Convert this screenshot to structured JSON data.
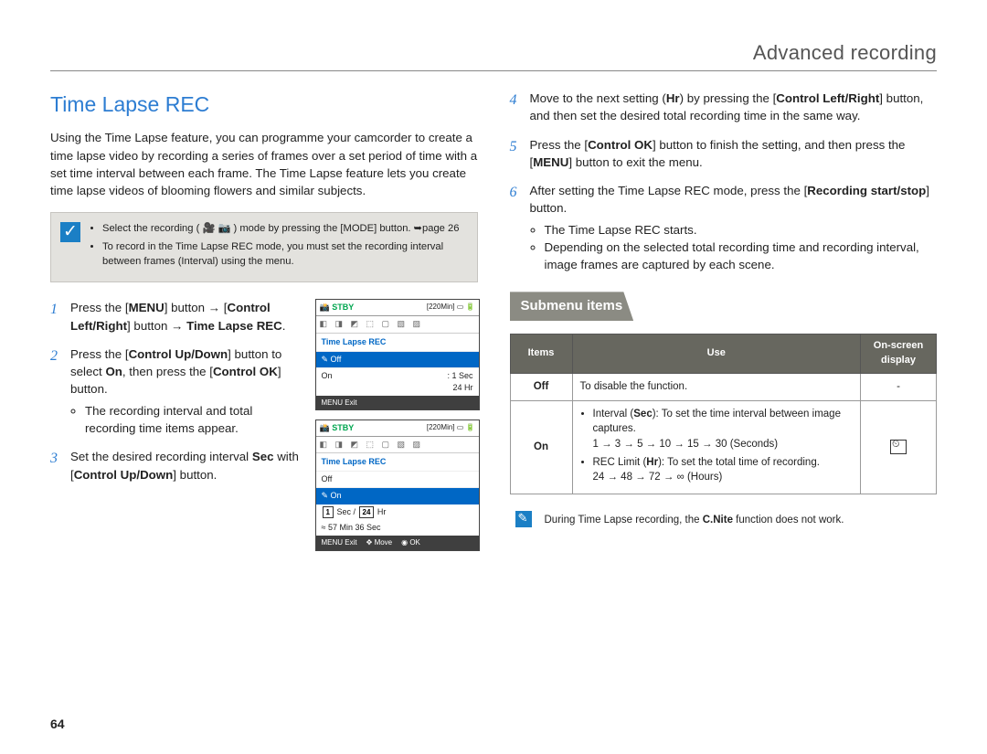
{
  "header": {
    "title": "Advanced recording"
  },
  "page_number": "64",
  "left": {
    "title": "Time Lapse REC",
    "intro": "Using the Time Lapse feature, you can programme your camcorder to create a time lapse video by recording a series of frames over a set period of time with a set time interval between each frame. The Time Lapse feature lets you create time lapse videos of blooming flowers and similar subjects.",
    "note_items": [
      "Select the recording (  🎥 📷  ) mode by pressing the [MODE] button. ➥page 26",
      "To record in the Time Lapse REC mode, you must set the recording interval between frames (Interval) using the menu."
    ],
    "steps": [
      "Press the [MENU] button → [Control Left/Right] button → Time Lapse REC.",
      "Press the [Control Up/Down] button to select On, then press the [Control OK] button.",
      "Set the desired recording interval Sec with [Control Up/Down] button."
    ],
    "step2_bullet": "The recording interval and total recording time items appear.",
    "screen1": {
      "stby": "STBY",
      "time": "[220Min]",
      "title": "Time Lapse REC",
      "row_off": "Off",
      "row_on": "On",
      "row_on_vals": ": 1 Sec",
      "row_on_vals2": "24 Hr",
      "exit": "Exit"
    },
    "screen2": {
      "stby": "STBY",
      "time": "[220Min]",
      "title": "Time Lapse REC",
      "row_off": "Off",
      "row_on": "On",
      "sec_val": "1",
      "sec_lbl": "Sec /",
      "hr_val": "24",
      "hr_lbl": "Hr",
      "result": "≈ 57 Min 36 Sec",
      "exit": "Exit",
      "move": "Move",
      "ok": "OK"
    }
  },
  "right": {
    "steps": [
      {
        "num": "4",
        "text": "Move to the next setting (Hr) by pressing the [Control Left/Right] button, and then set the desired total recording time in the same way."
      },
      {
        "num": "5",
        "text": "Press the [Control OK] button to finish the setting, and then press the [MENU] button to exit the menu."
      },
      {
        "num": "6",
        "text": "After setting the Time Lapse REC mode, press the [Recording start/stop] button."
      }
    ],
    "step6_bullets": [
      "The Time Lapse REC starts.",
      "Depending on the selected total recording time and recording interval, image frames are captured by each scene."
    ],
    "submenu_title": "Submenu items",
    "table": {
      "h1": "Items",
      "h2": "Use",
      "h3": "On-screen display",
      "r1c1": "Off",
      "r1c2": "To disable the function.",
      "r1c3": "-",
      "r2c1": "On",
      "r2_b1": "Interval (Sec): To set the time interval between image captures.",
      "r2_b1b": "1 → 3 → 5 → 10 → 15 → 30 (Seconds)",
      "r2_b2": "REC Limit (Hr): To set the total time of recording.",
      "r2_b2b": "24 → 48 → 72 → ∞ (Hours)"
    },
    "info": "During Time Lapse recording, the C.Nite function does not work."
  }
}
